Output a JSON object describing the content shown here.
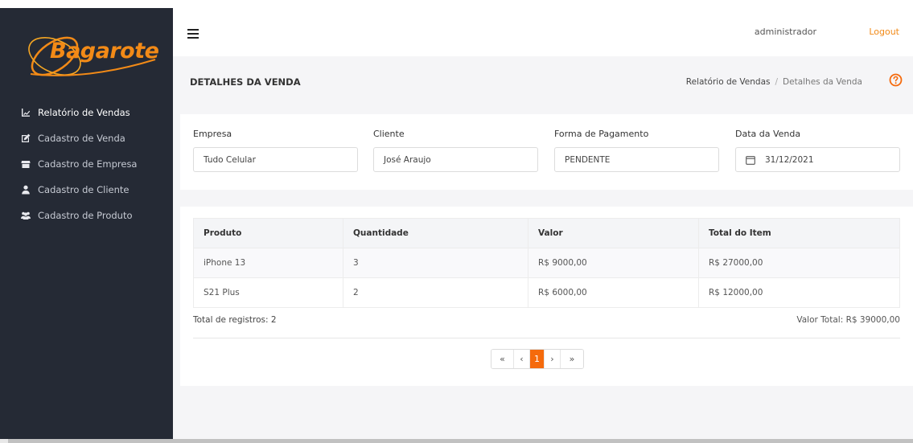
{
  "app": {
    "logo_text": "Bagarote",
    "brand_color": "#f28a17",
    "sidebar_bg": "#252a35",
    "accent": "#f56a0c"
  },
  "sidebar": {
    "items": [
      {
        "label": "Relatório de Vendas",
        "icon": "line-chart-icon"
      },
      {
        "label": "Cadastro de Venda",
        "icon": "edit-icon"
      },
      {
        "label": "Cadastro de Empresa",
        "icon": "store-icon"
      },
      {
        "label": "Cadastro de Cliente",
        "icon": "user-icon"
      },
      {
        "label": "Cadastro de Produto",
        "icon": "users-icon"
      }
    ]
  },
  "header": {
    "username": "administrador",
    "logout_label": "Logout",
    "menu_icon": "hamburger-icon"
  },
  "page": {
    "title": "DETALHES DA VENDA",
    "breadcrumb": [
      "Relatório de Vendas",
      "Detalhes da Venda"
    ],
    "breadcrumb_sep": "/",
    "help_icon": "question-circle-icon"
  },
  "form": {
    "empresa": {
      "label": "Empresa",
      "value": "Tudo Celular"
    },
    "cliente": {
      "label": "Cliente",
      "value": "José Araujo"
    },
    "pagamento": {
      "label": "Forma de Pagamento",
      "value": "PENDENTE"
    },
    "data": {
      "label": "Data da Venda",
      "value": "31/12/2021",
      "icon": "calendar-icon"
    }
  },
  "table": {
    "headers": [
      "Produto",
      "Quantidade",
      "Valor",
      "Total do Item"
    ],
    "rows": [
      [
        "iPhone 13",
        "3",
        "R$ 9000,00",
        "R$ 27000,00"
      ],
      [
        "S21 Plus",
        "2",
        "R$ 6000,00",
        "R$ 12000,00"
      ]
    ],
    "total_registros": "Total de registros: 2",
    "valor_total": "Valor Total: R$ 39000,00"
  },
  "pagination": {
    "first": "«",
    "prev": "‹",
    "current": "1",
    "next": "›",
    "last": "»"
  }
}
